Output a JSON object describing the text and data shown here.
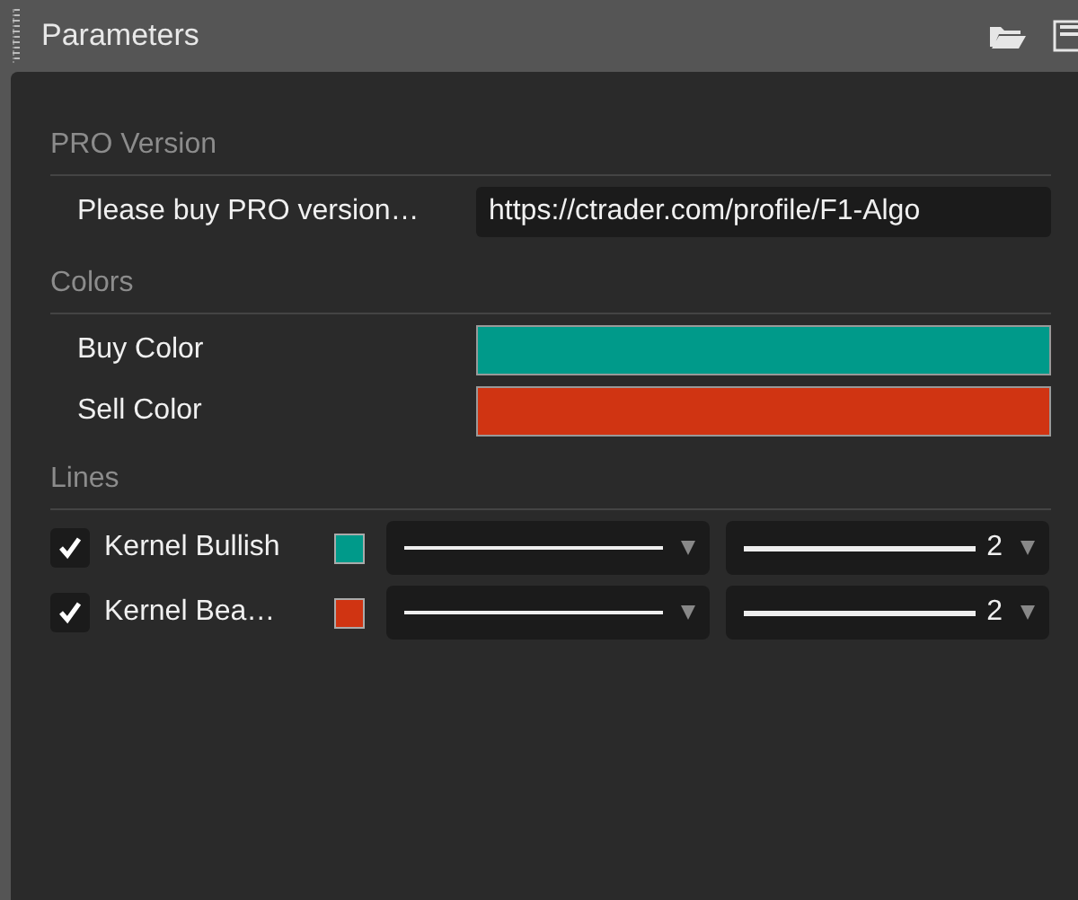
{
  "panel": {
    "title": "Parameters"
  },
  "sections": [
    {
      "heading": "PRO Version",
      "rows": [
        {
          "kind": "text",
          "label": "Please buy PRO version…",
          "value": "https://ctrader.com/profile/F1-Algo"
        }
      ]
    },
    {
      "heading": "Colors",
      "rows": [
        {
          "kind": "color",
          "label": "Buy Color",
          "color": "#009a8a"
        },
        {
          "kind": "color",
          "label": "Sell Color",
          "color": "#d03412"
        }
      ]
    },
    {
      "heading": "Lines",
      "rows": [
        {
          "kind": "line",
          "label": "Kernel Bullish",
          "checked": true,
          "color": "#009a8a",
          "thickness": "2"
        },
        {
          "kind": "line",
          "label": "Kernel Bea…",
          "checked": true,
          "color": "#d03412",
          "thickness": "2"
        }
      ]
    }
  ]
}
